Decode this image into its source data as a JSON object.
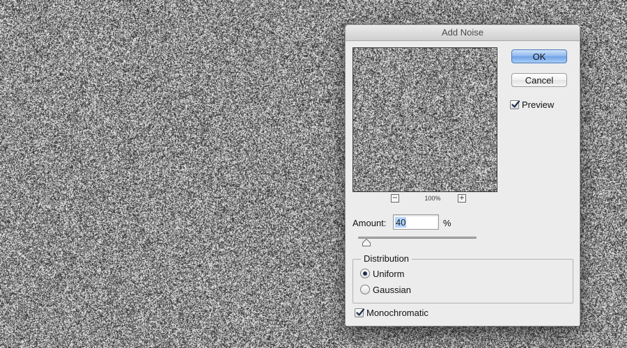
{
  "dialog": {
    "title": "Add Noise",
    "ok_label": "OK",
    "cancel_label": "Cancel",
    "preview_label": "Preview",
    "preview_checked": true,
    "zoom_level": "100%",
    "amount_label": "Amount:",
    "amount_value": "40",
    "amount_unit": "%",
    "amount_slider_fraction": 0.07,
    "distribution": {
      "title": "Distribution",
      "options": [
        {
          "label": "Uniform",
          "selected": true
        },
        {
          "label": "Gaussian",
          "selected": false
        }
      ]
    },
    "monochromatic_label": "Monochromatic",
    "monochromatic_checked": true
  },
  "colors": {
    "button_default": "#8bb6ef",
    "dialog_bg": "#ececec",
    "check_mark": "#1c2f4a"
  },
  "icons": {
    "zoom_out": "minus-icon",
    "zoom_in": "plus-icon",
    "check": "checkmark-icon"
  }
}
